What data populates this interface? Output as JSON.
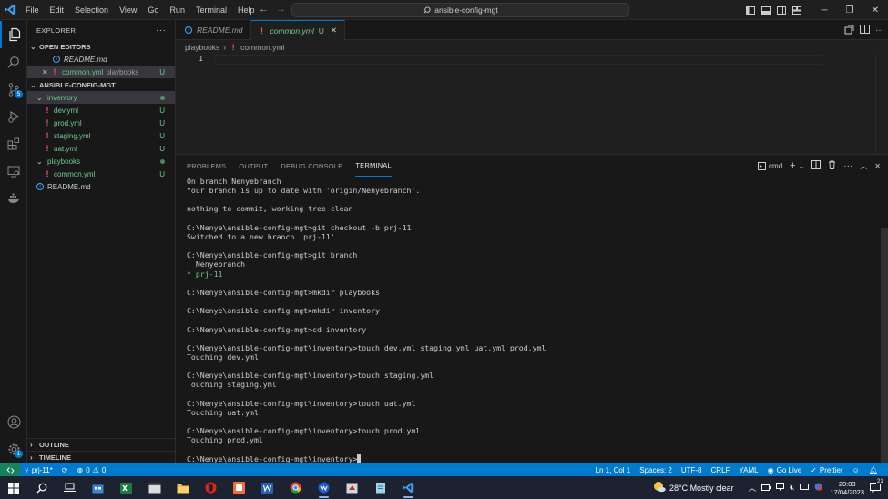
{
  "titlebar": {
    "menu": [
      "File",
      "Edit",
      "Selection",
      "View",
      "Go",
      "Run",
      "Terminal",
      "Help"
    ],
    "command_center": "ansible-config-mgt"
  },
  "sidebar": {
    "title": "EXPLORER",
    "open_editors_label": "OPEN EDITORS",
    "open_editors": [
      {
        "name": "README.md",
        "detail": ""
      },
      {
        "name": "common.yml",
        "detail": "playbooks",
        "status": "U"
      }
    ],
    "project_label": "ANSIBLE-CONFIG-MGT",
    "inventory_folder": "inventory",
    "inventory_files": [
      {
        "name": "dev.yml",
        "status": "U"
      },
      {
        "name": "prod.yml",
        "status": "U"
      },
      {
        "name": "staging.yml",
        "status": "U"
      },
      {
        "name": "uat.yml",
        "status": "U"
      }
    ],
    "playbooks_folder": "playbooks",
    "playbooks_files": [
      {
        "name": "common.yml",
        "status": "U"
      }
    ],
    "readme": "README.md",
    "outline_label": "OUTLINE",
    "timeline_label": "TIMELINE"
  },
  "tabs": [
    {
      "label": "README.md",
      "status": ""
    },
    {
      "label": "common.yml",
      "status": "U"
    }
  ],
  "breadcrumb": {
    "folder": "playbooks",
    "file": "common.yml"
  },
  "editor": {
    "line_number": "1"
  },
  "panel": {
    "tabs": [
      "PROBLEMS",
      "OUTPUT",
      "DEBUG CONSOLE",
      "TERMINAL"
    ],
    "shell": "cmd",
    "terminal_lines": [
      "On branch Nenyebranch",
      "Your branch is up to date with 'origin/Nenyebranch'.",
      "",
      "nothing to commit, working tree clean",
      "",
      "C:\\Nenye\\ansible-config-mgt>git checkout -b prj-11",
      "Switched to a new branch 'prj-11'",
      "",
      "C:\\Nenye\\ansible-config-mgt>git branch",
      "  Nenyebranch",
      "* prj-11",
      "",
      "C:\\Nenye\\ansible-config-mgt>mkdir playbooks",
      "",
      "C:\\Nenye\\ansible-config-mgt>mkdir inventory",
      "",
      "C:\\Nenye\\ansible-config-mgt>cd inventory",
      "",
      "C:\\Nenye\\ansible-config-mgt\\inventory>touch dev.yml staging.yml uat.yml prod.yml",
      "Touching dev.yml",
      "",
      "C:\\Nenye\\ansible-config-mgt\\inventory>touch staging.yml",
      "Touching staging.yml",
      "",
      "C:\\Nenye\\ansible-config-mgt\\inventory>touch uat.yml",
      "Touching uat.yml",
      "",
      "C:\\Nenye\\ansible-config-mgt\\inventory>touch prod.yml",
      "Touching prod.yml",
      "",
      "C:\\Nenye\\ansible-config-mgt\\inventory>"
    ]
  },
  "statusbar": {
    "branch": "prj-11*",
    "errors": "0",
    "warnings": "0",
    "position": "Ln 1, Col 1",
    "spaces": "Spaces: 2",
    "encoding": "UTF-8",
    "eol": "CRLF",
    "language": "YAML",
    "golive": "Go Live",
    "prettier": "Prettier"
  },
  "taskbar": {
    "weather": "28°C  Mostly clear",
    "time": "20:03",
    "date": "17/04/2023",
    "notifications": "21"
  },
  "colors": {
    "accent": "#0078d4",
    "status_bar": "#007acc",
    "untracked": "#73c991",
    "yaml_icon": "#e44d9a"
  }
}
